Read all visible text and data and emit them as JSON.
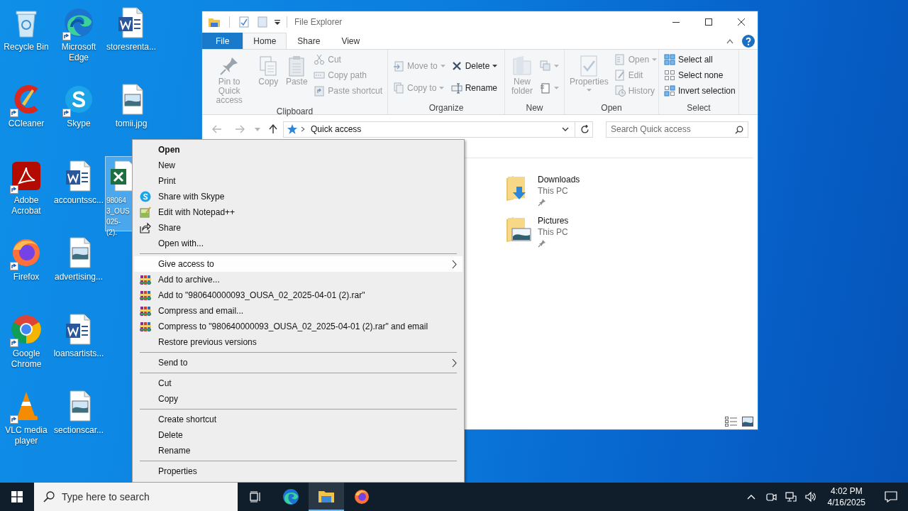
{
  "desktop_icons": [
    {
      "label": "Recycle Bin",
      "kind": "recycle",
      "shortcut": false,
      "selected": false
    },
    {
      "label": "CCleaner",
      "kind": "ccleaner",
      "shortcut": true,
      "selected": false
    },
    {
      "label": "Adobe Acrobat",
      "kind": "acrobat",
      "shortcut": true,
      "selected": false
    },
    {
      "label": "Firefox",
      "kind": "firefox",
      "shortcut": true,
      "selected": false
    },
    {
      "label": "Google Chrome",
      "kind": "chrome",
      "shortcut": true,
      "selected": false
    },
    {
      "label": "VLC media player",
      "kind": "vlc",
      "shortcut": true,
      "selected": false
    },
    {
      "label": "Microsoft Edge",
      "kind": "edge",
      "shortcut": true,
      "selected": false
    },
    {
      "label": "Skype",
      "kind": "skype",
      "shortcut": true,
      "selected": false
    },
    {
      "label": "accountssc...",
      "kind": "word",
      "shortcut": false,
      "selected": false
    },
    {
      "label": "advertising...",
      "kind": "image",
      "shortcut": false,
      "selected": false
    },
    {
      "label": "loansartists...",
      "kind": "word",
      "shortcut": false,
      "selected": false
    },
    {
      "label": "sectionscar...",
      "kind": "image",
      "shortcut": false,
      "selected": false
    },
    {
      "label": "storesrenta...",
      "kind": "word",
      "shortcut": false,
      "selected": false
    },
    {
      "label": "tomii.jpg",
      "kind": "image",
      "shortcut": false,
      "selected": false
    },
    {
      "label": "98064\n3_OUS\n025-\n(2).",
      "kind": "excel",
      "shortcut": false,
      "selected": true
    }
  ],
  "explorer": {
    "title": "File Explorer",
    "ribbon_tabs": [
      {
        "label": "File",
        "kind": "file",
        "selected": false
      },
      {
        "label": "Home",
        "kind": "tab",
        "selected": true
      },
      {
        "label": "Share",
        "kind": "tab",
        "selected": false
      },
      {
        "label": "View",
        "kind": "tab",
        "selected": false
      }
    ],
    "ribbon_groups": [
      {
        "label": "Clipboard",
        "columns": [
          [
            {
              "label": "Pin to Quick access",
              "kind": "pin",
              "large": true,
              "disabled": true,
              "dropdown": false
            }
          ],
          [
            {
              "label": "Copy",
              "kind": "copy",
              "large": true,
              "disabled": true,
              "dropdown": false
            }
          ],
          [
            {
              "label": "Paste",
              "kind": "paste",
              "large": true,
              "disabled": true,
              "dropdown": false
            }
          ],
          [
            {
              "label": "Cut",
              "kind": "cut",
              "large": false,
              "disabled": true,
              "dropdown": false
            },
            {
              "label": "Copy path",
              "kind": "copypath",
              "large": false,
              "disabled": true,
              "dropdown": false
            },
            {
              "label": "Paste shortcut",
              "kind": "pasteshortcut",
              "large": false,
              "disabled": true,
              "dropdown": false
            }
          ]
        ]
      },
      {
        "label": "Organize",
        "columns": [
          [
            {
              "label": "Move to",
              "kind": "moveto",
              "large": false,
              "disabled": true,
              "dropdown": true
            },
            {
              "label": "Copy to",
              "kind": "copyto",
              "large": false,
              "disabled": true,
              "dropdown": true
            }
          ],
          [
            {
              "label": "Delete",
              "kind": "delete",
              "large": false,
              "disabled": false,
              "dropdown": true
            },
            {
              "label": "Rename",
              "kind": "rename",
              "large": false,
              "disabled": false,
              "dropdown": false
            }
          ]
        ]
      },
      {
        "label": "New",
        "columns": [
          [
            {
              "label": "New folder",
              "kind": "newfolder",
              "large": true,
              "disabled": true,
              "dropdown": false
            }
          ],
          [
            {
              "kind": "newitem",
              "large": false,
              "disabled": true,
              "dropdown": true
            },
            {
              "kind": "easyaccess",
              "large": false,
              "disabled": true,
              "dropdown": true
            }
          ]
        ]
      },
      {
        "label": "Open",
        "columns": [
          [
            {
              "label": "Properties",
              "kind": "properties",
              "large": true,
              "disabled": true,
              "dropdown": true
            }
          ],
          [
            {
              "label": "Open",
              "kind": "open",
              "large": false,
              "disabled": true,
              "dropdown": true
            },
            {
              "label": "Edit",
              "kind": "edit",
              "large": false,
              "disabled": true,
              "dropdown": false
            },
            {
              "label": "History",
              "kind": "history",
              "large": false,
              "disabled": true,
              "dropdown": false
            }
          ]
        ]
      },
      {
        "label": "Select",
        "columns": [
          [
            {
              "label": "Select all",
              "kind": "selectall",
              "large": false,
              "disabled": false,
              "dropdown": false
            },
            {
              "label": "Select none",
              "kind": "selectnone",
              "large": false,
              "disabled": false,
              "dropdown": false
            },
            {
              "label": "Invert selection",
              "kind": "invert",
              "large": false,
              "disabled": false,
              "dropdown": false
            }
          ]
        ]
      }
    ],
    "address": "Quick access",
    "search_placeholder": "Search Quick access",
    "items": [
      {
        "name": "Downloads",
        "location": "This PC",
        "kind": "downloads",
        "pinned": true
      },
      {
        "name": "Pictures",
        "location": "This PC",
        "kind": "pictures",
        "pinned": true
      }
    ]
  },
  "context_menu": [
    {
      "label": "Open",
      "kind": "text",
      "default": true,
      "highlighted": false,
      "submenu": false
    },
    {
      "label": "New",
      "kind": "text",
      "default": false,
      "highlighted": false,
      "submenu": false
    },
    {
      "label": "Print",
      "kind": "text",
      "default": false,
      "highlighted": false,
      "submenu": false
    },
    {
      "label": "Share with Skype",
      "kind": "skype",
      "default": false,
      "highlighted": false,
      "submenu": false
    },
    {
      "label": "Edit with Notepad++",
      "kind": "notepad",
      "default": false,
      "highlighted": false,
      "submenu": false
    },
    {
      "label": "Share",
      "kind": "share",
      "default": false,
      "highlighted": false,
      "submenu": false
    },
    {
      "label": "Open with...",
      "kind": "text",
      "default": false,
      "highlighted": false,
      "submenu": false
    },
    {
      "kind": "separator"
    },
    {
      "label": "Give access to",
      "kind": "text",
      "default": false,
      "highlighted": true,
      "submenu": true
    },
    {
      "label": "Add to archive...",
      "kind": "archive",
      "default": false,
      "highlighted": false,
      "submenu": false
    },
    {
      "label": "Add to \"980640000093_OUSA_02_2025-04-01 (2).rar\"",
      "kind": "archive",
      "default": false,
      "highlighted": false,
      "submenu": false
    },
    {
      "label": "Compress and email...",
      "kind": "archive",
      "default": false,
      "highlighted": false,
      "submenu": false
    },
    {
      "label": "Compress to \"980640000093_OUSA_02_2025-04-01 (2).rar\" and email",
      "kind": "archive",
      "default": false,
      "highlighted": false,
      "submenu": false
    },
    {
      "label": "Restore previous versions",
      "kind": "text",
      "default": false,
      "highlighted": false,
      "submenu": false
    },
    {
      "kind": "separator"
    },
    {
      "label": "Send to",
      "kind": "text",
      "default": false,
      "highlighted": false,
      "submenu": true
    },
    {
      "kind": "separator"
    },
    {
      "label": "Cut",
      "kind": "text",
      "default": false,
      "highlighted": false,
      "submenu": false
    },
    {
      "label": "Copy",
      "kind": "text",
      "default": false,
      "highlighted": false,
      "submenu": false
    },
    {
      "kind": "separator"
    },
    {
      "label": "Create shortcut",
      "kind": "text",
      "default": false,
      "highlighted": false,
      "submenu": false
    },
    {
      "label": "Delete",
      "kind": "text",
      "default": false,
      "highlighted": false,
      "submenu": false
    },
    {
      "label": "Rename",
      "kind": "text",
      "default": false,
      "highlighted": false,
      "submenu": false
    },
    {
      "kind": "separator"
    },
    {
      "label": "Properties",
      "kind": "text",
      "default": false,
      "highlighted": false,
      "submenu": false
    }
  ],
  "taskbar": {
    "search_placeholder": "Type here to search",
    "apps": [
      {
        "kind": "taskview",
        "open": false
      },
      {
        "kind": "edge",
        "open": false
      },
      {
        "kind": "explorer",
        "open": true
      },
      {
        "kind": "firefox",
        "open": false
      }
    ],
    "time": "4:02 PM",
    "date": "4/16/2025"
  }
}
